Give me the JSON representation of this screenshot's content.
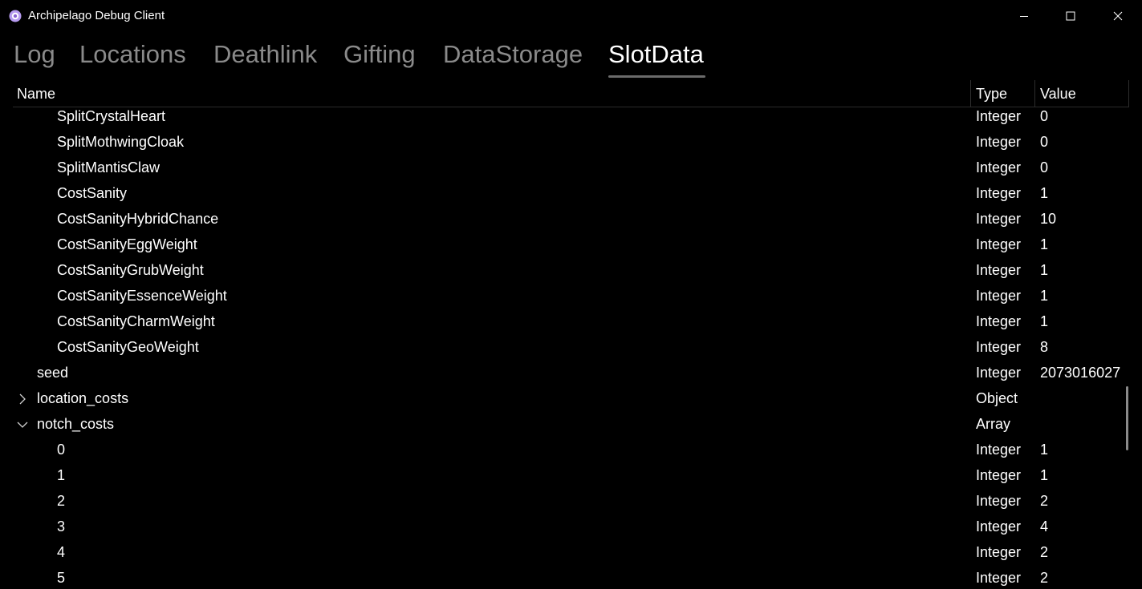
{
  "window": {
    "title": "Archipelago Debug Client",
    "accent_color": "#8a63d2"
  },
  "tabs": [
    {
      "label": "Log",
      "active": false
    },
    {
      "label": "Locations",
      "active": false
    },
    {
      "label": "Deathlink",
      "active": false
    },
    {
      "label": "Gifting",
      "active": false
    },
    {
      "label": "DataStorage",
      "active": false
    },
    {
      "label": "SlotData",
      "active": true
    }
  ],
  "grid": {
    "columns": {
      "name": "Name",
      "type": "Type",
      "value": "Value"
    },
    "rows": [
      {
        "name": "SplitCrystalHeart",
        "type": "Integer",
        "value": "0",
        "depth": 2,
        "expander": ""
      },
      {
        "name": "SplitMothwingCloak",
        "type": "Integer",
        "value": "0",
        "depth": 2,
        "expander": ""
      },
      {
        "name": "SplitMantisClaw",
        "type": "Integer",
        "value": "0",
        "depth": 2,
        "expander": ""
      },
      {
        "name": "CostSanity",
        "type": "Integer",
        "value": "1",
        "depth": 2,
        "expander": ""
      },
      {
        "name": "CostSanityHybridChance",
        "type": "Integer",
        "value": "10",
        "depth": 2,
        "expander": ""
      },
      {
        "name": "CostSanityEggWeight",
        "type": "Integer",
        "value": "1",
        "depth": 2,
        "expander": ""
      },
      {
        "name": "CostSanityGrubWeight",
        "type": "Integer",
        "value": "1",
        "depth": 2,
        "expander": ""
      },
      {
        "name": "CostSanityEssenceWeight",
        "type": "Integer",
        "value": "1",
        "depth": 2,
        "expander": ""
      },
      {
        "name": "CostSanityCharmWeight",
        "type": "Integer",
        "value": "1",
        "depth": 2,
        "expander": ""
      },
      {
        "name": "CostSanityGeoWeight",
        "type": "Integer",
        "value": "8",
        "depth": 2,
        "expander": ""
      },
      {
        "name": "seed",
        "type": "Integer",
        "value": "2073016027",
        "depth": 1,
        "expander": ""
      },
      {
        "name": "location_costs",
        "type": "Object",
        "value": "",
        "depth": 1,
        "expander": "collapsed"
      },
      {
        "name": "notch_costs",
        "type": "Array",
        "value": "",
        "depth": 1,
        "expander": "expanded"
      },
      {
        "name": "0",
        "type": "Integer",
        "value": "1",
        "depth": 2,
        "expander": ""
      },
      {
        "name": "1",
        "type": "Integer",
        "value": "1",
        "depth": 2,
        "expander": ""
      },
      {
        "name": "2",
        "type": "Integer",
        "value": "2",
        "depth": 2,
        "expander": ""
      },
      {
        "name": "3",
        "type": "Integer",
        "value": "4",
        "depth": 2,
        "expander": ""
      },
      {
        "name": "4",
        "type": "Integer",
        "value": "2",
        "depth": 2,
        "expander": ""
      },
      {
        "name": "5",
        "type": "Integer",
        "value": "2",
        "depth": 2,
        "expander": ""
      }
    ]
  }
}
